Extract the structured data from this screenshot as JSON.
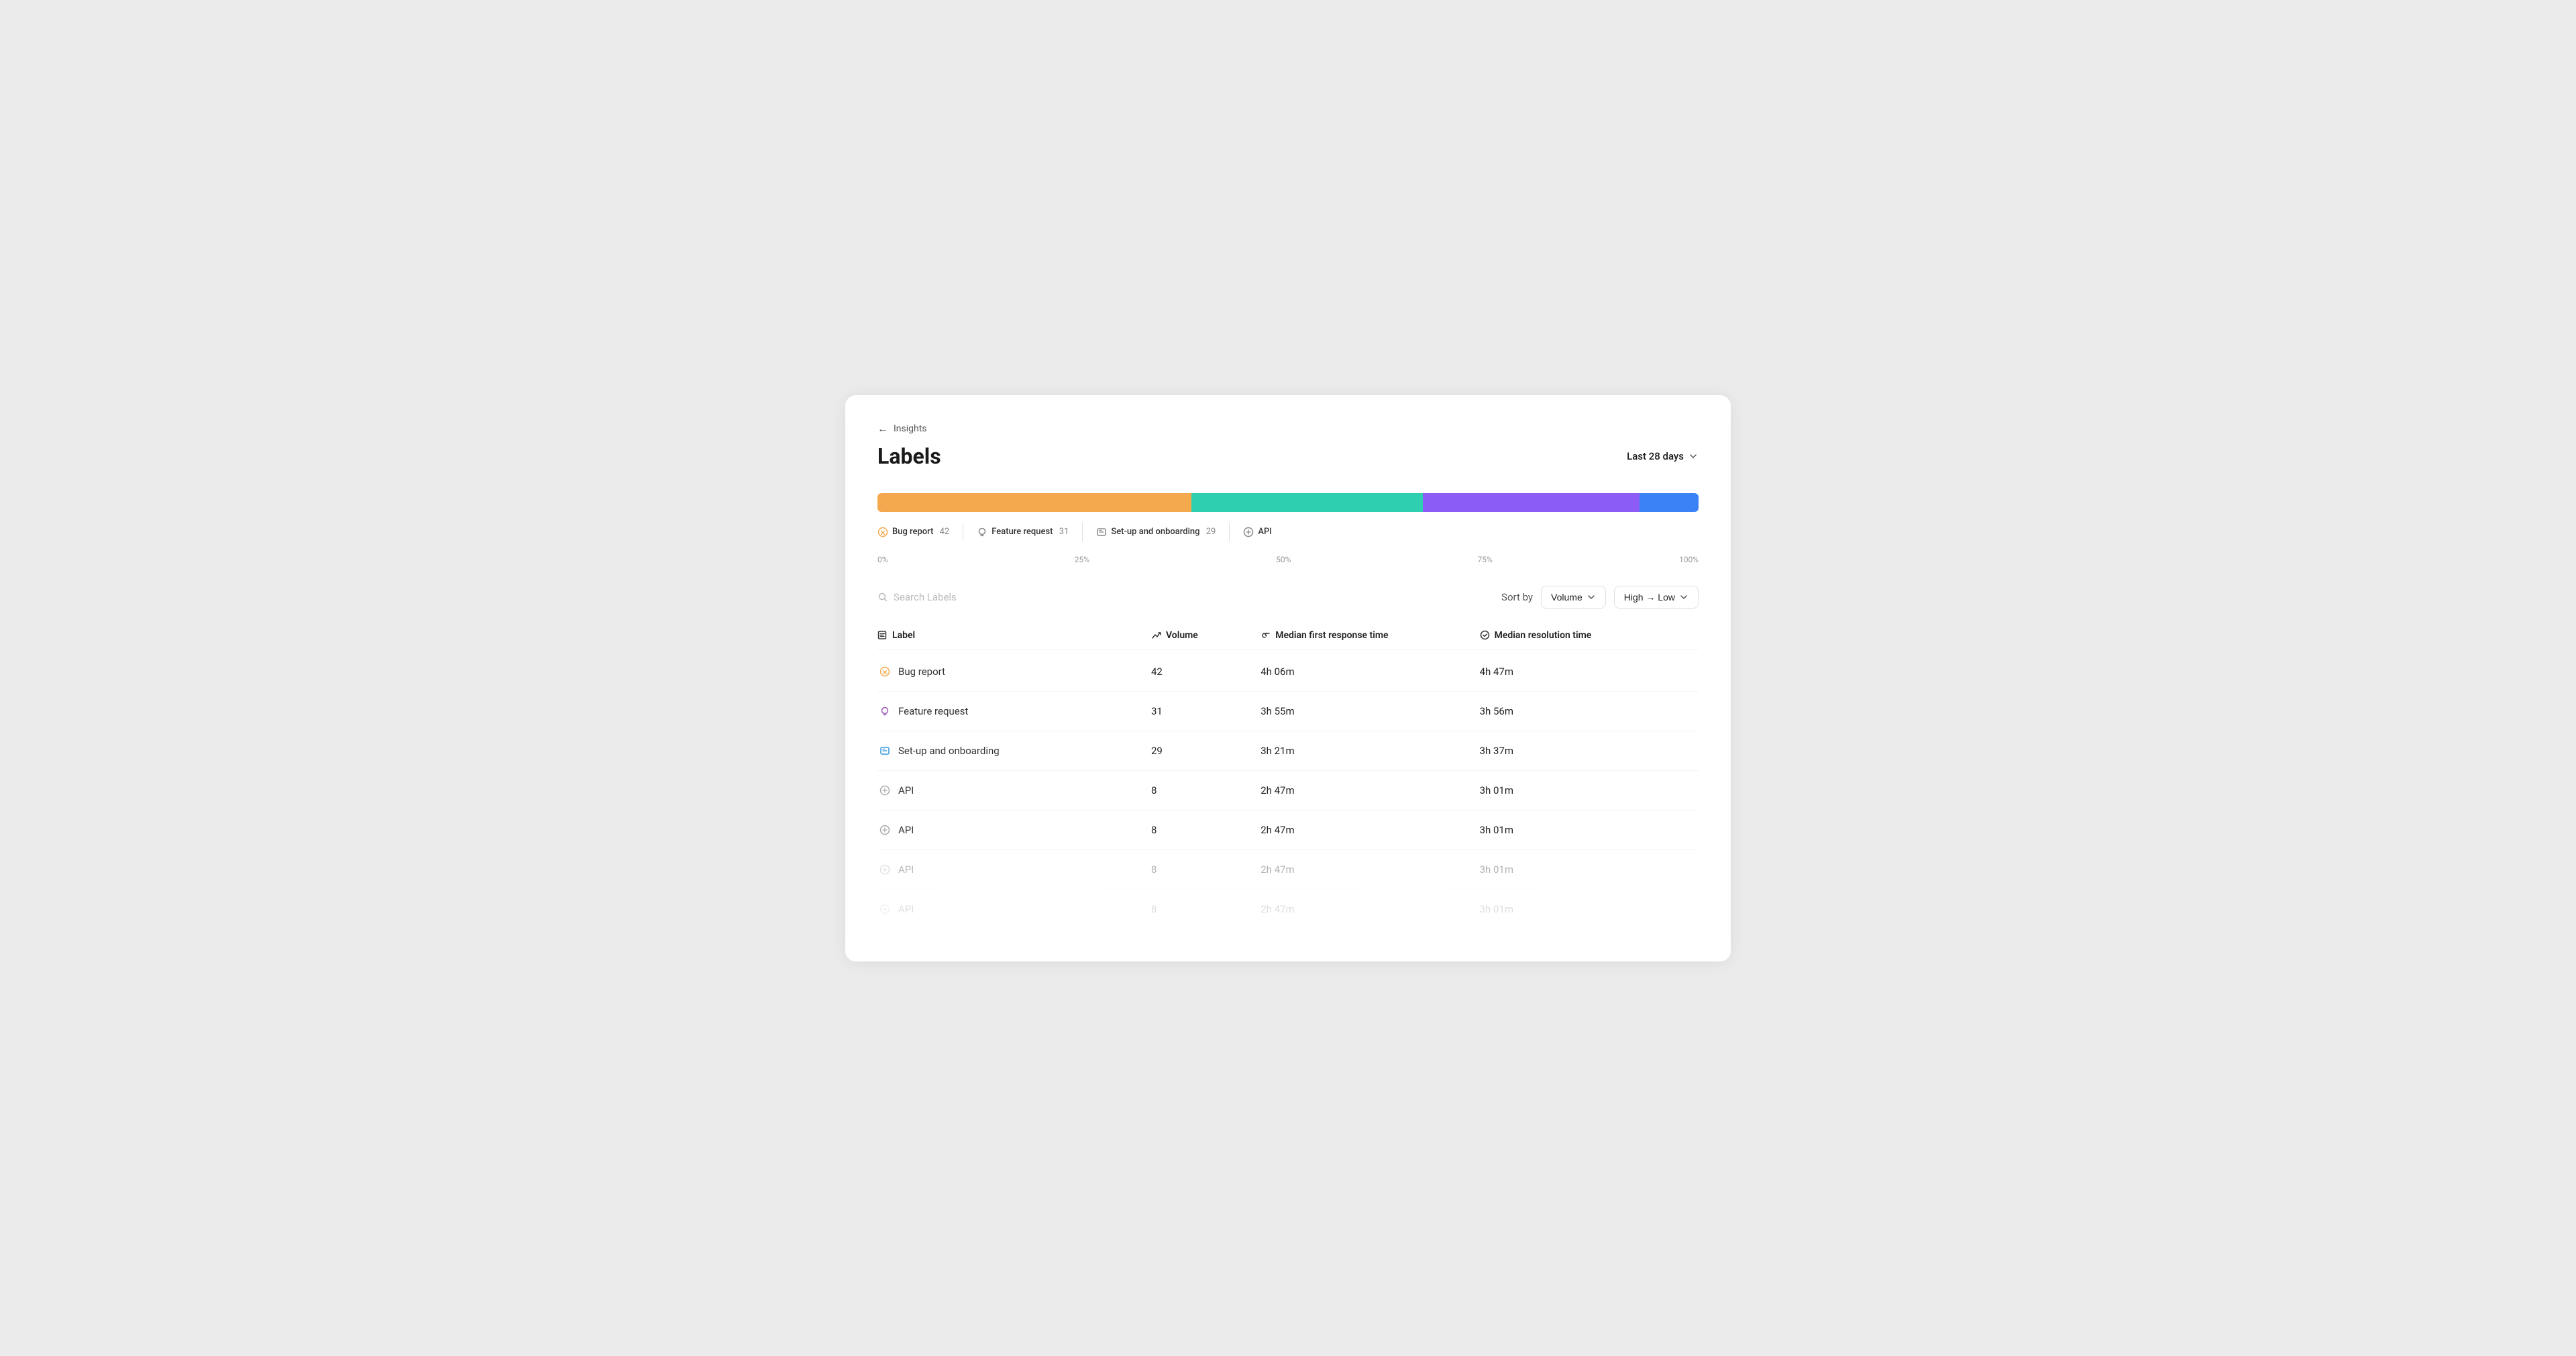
{
  "breadcrumb": {
    "arrow": "←",
    "label": "Insights"
  },
  "header": {
    "title": "Labels",
    "date_filter": "Last 28 days",
    "chevron": "▾"
  },
  "bar_chart": {
    "segments": [
      {
        "id": "bug-report",
        "color": "#f5a94e",
        "width_pct": 38.2,
        "label": "Bug report",
        "count": 42
      },
      {
        "id": "feature-request",
        "color": "#2ecfb1",
        "width_pct": 28.2,
        "label": "Feature request",
        "count": 31
      },
      {
        "id": "setup-onboarding",
        "color": "#8b5cf6",
        "width_pct": 26.4,
        "label": "Set-up and onboarding",
        "count": 29
      },
      {
        "id": "api",
        "color": "#3b82f6",
        "width_pct": 7.2,
        "label": "API",
        "count": 8
      }
    ],
    "percentages": [
      "0%",
      "25%",
      "50%",
      "75%",
      "100%"
    ]
  },
  "controls": {
    "search_placeholder": "Search Labels",
    "sort_by_label": "Sort by",
    "sort_volume_label": "Volume",
    "sort_direction_label": "High → Low"
  },
  "table": {
    "headers": [
      {
        "id": "label",
        "icon": "tag",
        "label": "Label"
      },
      {
        "id": "volume",
        "icon": "trending-up",
        "label": "Volume"
      },
      {
        "id": "median-first-response",
        "icon": "reply",
        "label": "Median first response time"
      },
      {
        "id": "median-resolution",
        "icon": "check-circle",
        "label": "Median resolution time"
      }
    ],
    "rows": [
      {
        "id": "bug-report",
        "label": "Bug report",
        "icon_type": "bug",
        "volume": "42",
        "first_response": "4h 06m",
        "resolution": "4h 47m",
        "faded": false
      },
      {
        "id": "feature-request",
        "label": "Feature request",
        "icon_type": "feature",
        "volume": "31",
        "first_response": "3h 55m",
        "resolution": "3h 56m",
        "faded": false
      },
      {
        "id": "setup-onboarding",
        "label": "Set-up and onboarding",
        "icon_type": "setup",
        "volume": "29",
        "first_response": "3h 21m",
        "resolution": "3h 37m",
        "faded": false
      },
      {
        "id": "api-1",
        "label": "API",
        "icon_type": "api",
        "volume": "8",
        "first_response": "2h 47m",
        "resolution": "3h 01m",
        "faded": false
      },
      {
        "id": "api-2",
        "label": "API",
        "icon_type": "api",
        "volume": "8",
        "first_response": "2h 47m",
        "resolution": "3h 01m",
        "faded": false
      },
      {
        "id": "api-3",
        "label": "API",
        "icon_type": "api",
        "volume": "8",
        "first_response": "2h 47m",
        "resolution": "3h 01m",
        "faded": true
      },
      {
        "id": "api-4",
        "label": "API",
        "icon_type": "api",
        "volume": "8",
        "first_response": "2h 47m",
        "resolution": "3h 01m",
        "very_faded": true
      }
    ]
  },
  "icons": {
    "bug": "⚙",
    "feature": "💡",
    "setup": "🚩",
    "api": "⚙",
    "tag": "◻",
    "trending-up": "↗",
    "reply": "↩",
    "check-circle": "✓",
    "search": "🔍",
    "chevron-down": "⌄",
    "back-arrow": "←"
  }
}
